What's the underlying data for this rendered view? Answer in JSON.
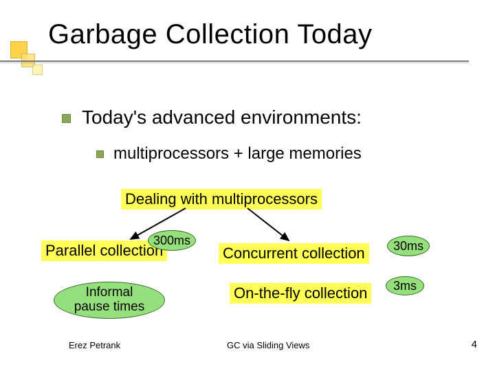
{
  "title": "Garbage Collection Today",
  "bullets": {
    "lvl1": "Today's advanced environments:",
    "lvl2": "multiprocessors + large memories"
  },
  "boxes": {
    "dealing": "Dealing with multiprocessors",
    "parallel": "Parallel collection",
    "concurrent": "Concurrent collection",
    "onthefly": "On-the-fly collection"
  },
  "times": {
    "t300": "300ms",
    "t30": "30ms",
    "t3": "3ms"
  },
  "informal": {
    "line1": "Informal",
    "line2": "pause times"
  },
  "footer": {
    "left": "Erez Petrank",
    "center": "GC via Sliding Views",
    "right": "4"
  }
}
